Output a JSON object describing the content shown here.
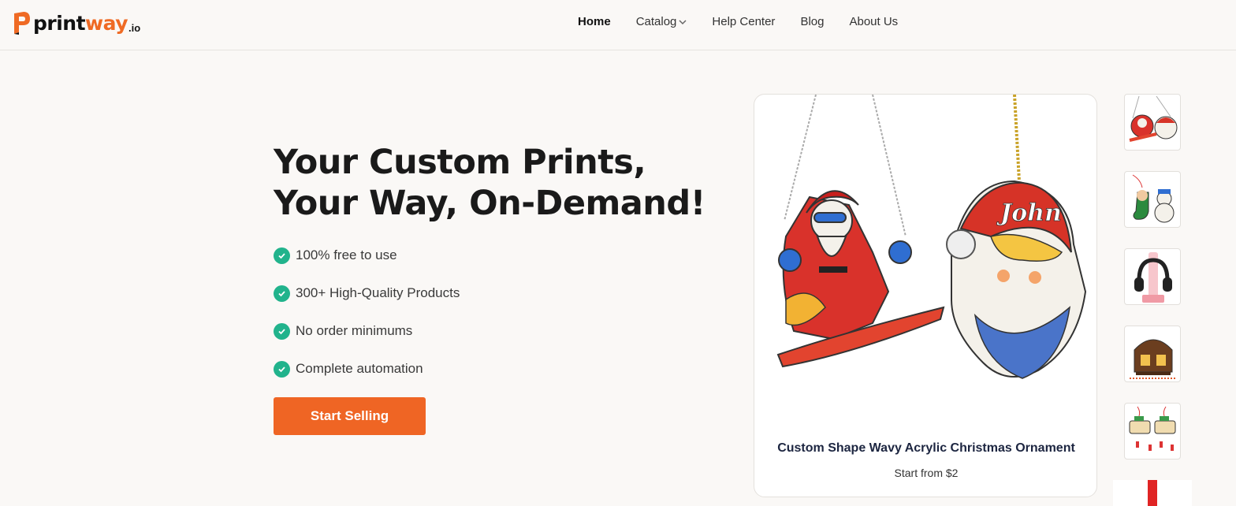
{
  "brand": {
    "name_part1": "print",
    "name_part2": "way",
    "tld": ".io",
    "accent": "#ef6a24"
  },
  "nav": {
    "items": [
      {
        "label": "Home",
        "active": true
      },
      {
        "label": "Catalog",
        "dropdown": true
      },
      {
        "label": "Help Center"
      },
      {
        "label": "Blog"
      },
      {
        "label": "About Us"
      }
    ]
  },
  "hero": {
    "title_line1": "Your Custom Prints,",
    "title_line2": "Your Way, On-Demand!",
    "features": [
      "100% free to use",
      "300+ High-Quality Products",
      "No order minimums",
      "Complete automation"
    ],
    "cta_label": "Start Selling",
    "cta_color": "#ef6524",
    "check_color": "#21b38c"
  },
  "product": {
    "title": "Custom Shape Wavy Acrylic Christmas Ornament",
    "price": "Start from $2",
    "ornament_name": "John"
  },
  "thumbnails": [
    "santa-ornaments-thumbnail",
    "stocking-snowman-thumbnail",
    "headphone-stand-thumbnail",
    "house-plaque-thumbnail",
    "truck-ornaments-thumbnail"
  ]
}
